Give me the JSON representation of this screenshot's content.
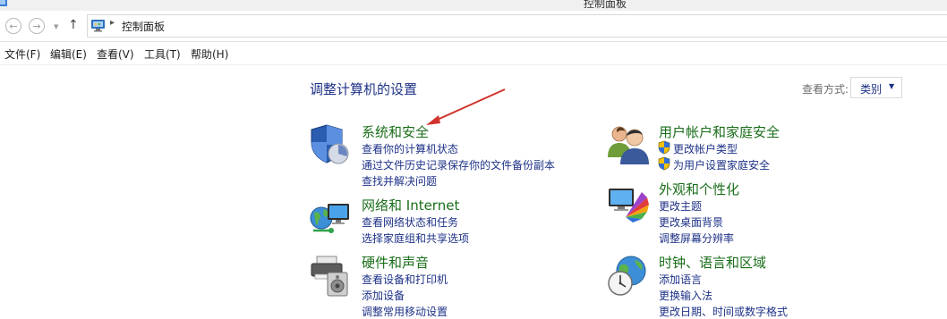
{
  "window": {
    "title": "控制面板"
  },
  "nav": {
    "back_glyph": "←",
    "forward_glyph": "→",
    "history_glyph": "▼",
    "up_glyph": "↑"
  },
  "address": {
    "separator": "▸",
    "crumb": "控制面板"
  },
  "menu": [
    {
      "label": "文件(F)"
    },
    {
      "label": "编辑(E)"
    },
    {
      "label": "查看(V)"
    },
    {
      "label": "工具(T)"
    },
    {
      "label": "帮助(H)"
    }
  ],
  "main": {
    "heading": "调整计算机的设置",
    "view_by": {
      "label": "查看方式:",
      "value": "类别",
      "caret": "▼"
    },
    "categories": [
      {
        "title": "系统和安全",
        "icon": "system-security-icon",
        "links": [
          "查看你的计算机状态",
          "通过文件历史记录保存你的文件备份副本",
          "查找并解决问题"
        ]
      },
      {
        "title": "网络和 Internet",
        "icon": "network-icon",
        "links": [
          "查看网络状态和任务",
          "选择家庭组和共享选项"
        ]
      },
      {
        "title": "硬件和声音",
        "icon": "hardware-sound-icon",
        "links": [
          "查看设备和打印机",
          "添加设备",
          "调整常用移动设置"
        ]
      },
      {
        "title": "用户帐户和家庭安全",
        "icon": "user-accounts-icon",
        "links": [
          "更改帐户类型",
          "为用户设置家庭安全"
        ]
      },
      {
        "title": "外观和个性化",
        "icon": "appearance-icon",
        "links": [
          "更改主题",
          "更改桌面背景",
          "调整屏幕分辨率"
        ]
      },
      {
        "title": "时钟、语言和区域",
        "icon": "clock-language-icon",
        "links": [
          "添加语言",
          "更换输入法",
          "更改日期、时间或数字格式"
        ]
      }
    ]
  },
  "colors": {
    "link": "#1e3287",
    "category_title": "#1a6e1a",
    "annotation_arrow": "#d0342c"
  }
}
